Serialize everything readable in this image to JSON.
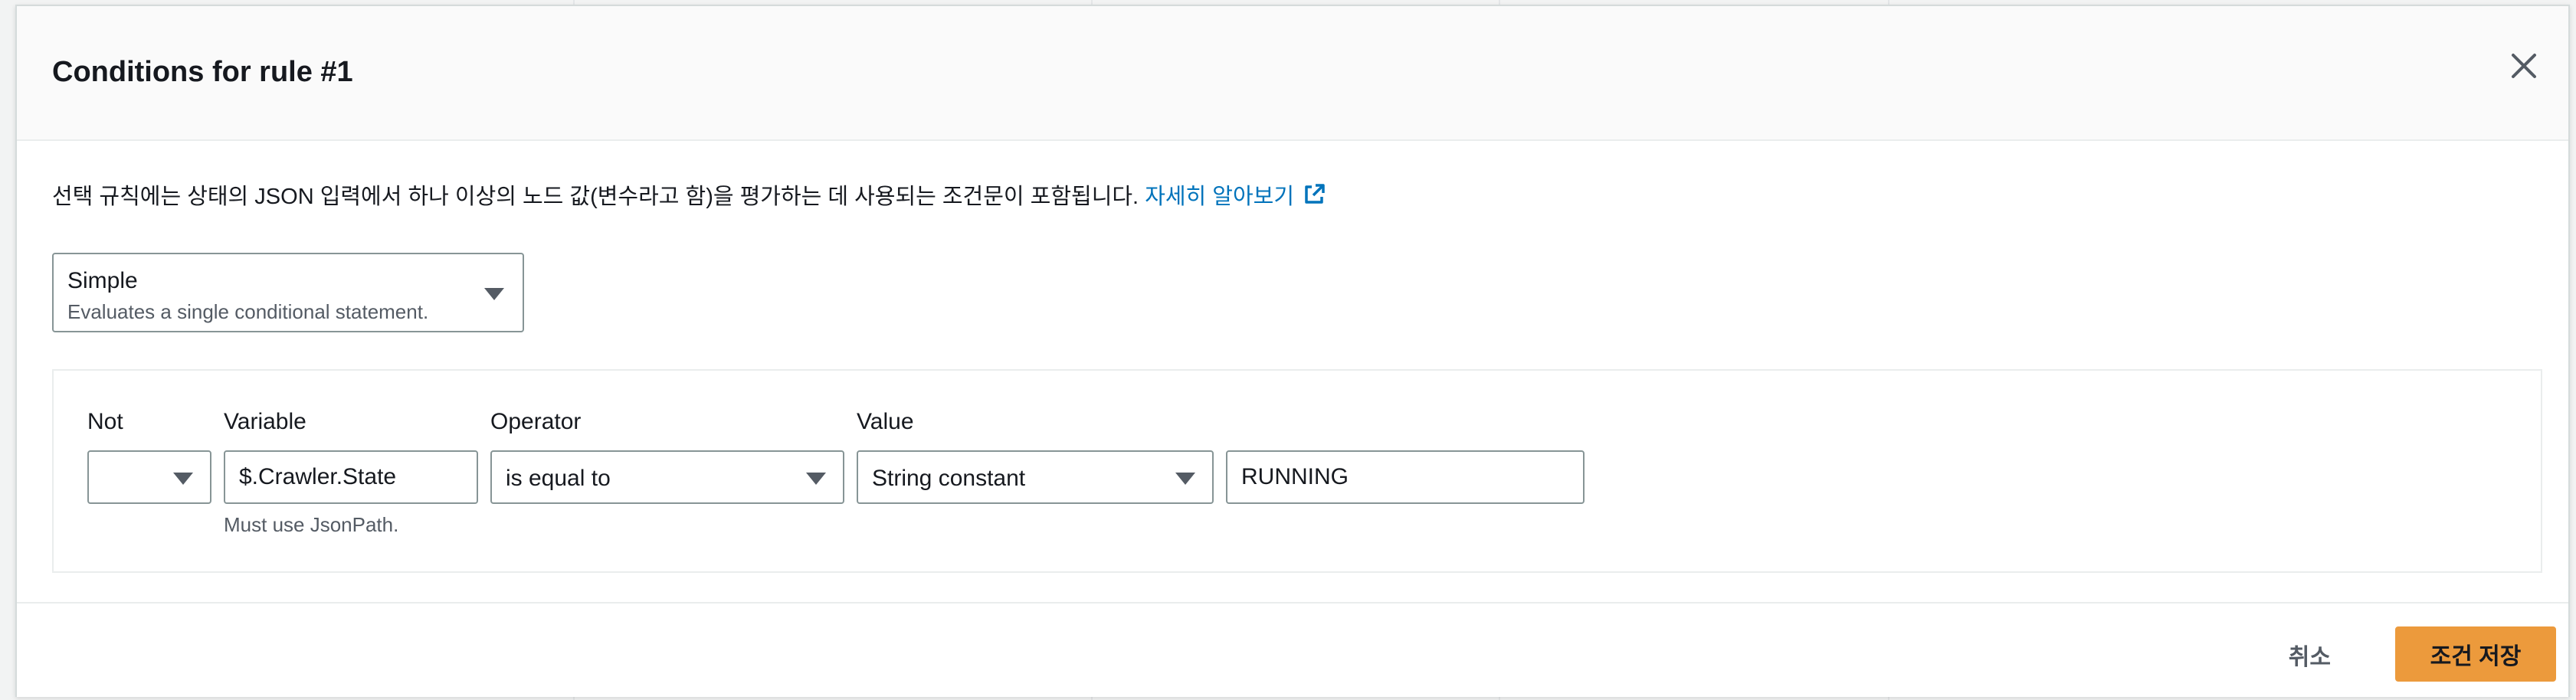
{
  "modal": {
    "title": "Conditions for rule #1",
    "close_icon": "close-icon"
  },
  "description": {
    "text": "선택 규칙에는 상태의 JSON 입력에서 하나 이상의 노드 값(변수라고 함)을 평가하는 데 사용되는 조건문이 포함됩니다. ",
    "learn_more": "자세히 알아보기",
    "learn_more_icon": "external-link-icon",
    "link_color": "#0073bb"
  },
  "condition_type": {
    "selected": "Simple",
    "description": "Evaluates a single conditional statement."
  },
  "condition": {
    "not_label": "Not",
    "not_value": "",
    "variable_label": "Variable",
    "variable_value": "$.Crawler.State",
    "variable_hint": "Must use JsonPath.",
    "operator_label": "Operator",
    "operator_value": "is equal to",
    "value_label": "Value",
    "value_type": "String constant",
    "value_text": "RUNNING"
  },
  "footer": {
    "cancel_label": "취소",
    "save_label": "조건 저장",
    "primary_color": "#ec9a3c"
  }
}
